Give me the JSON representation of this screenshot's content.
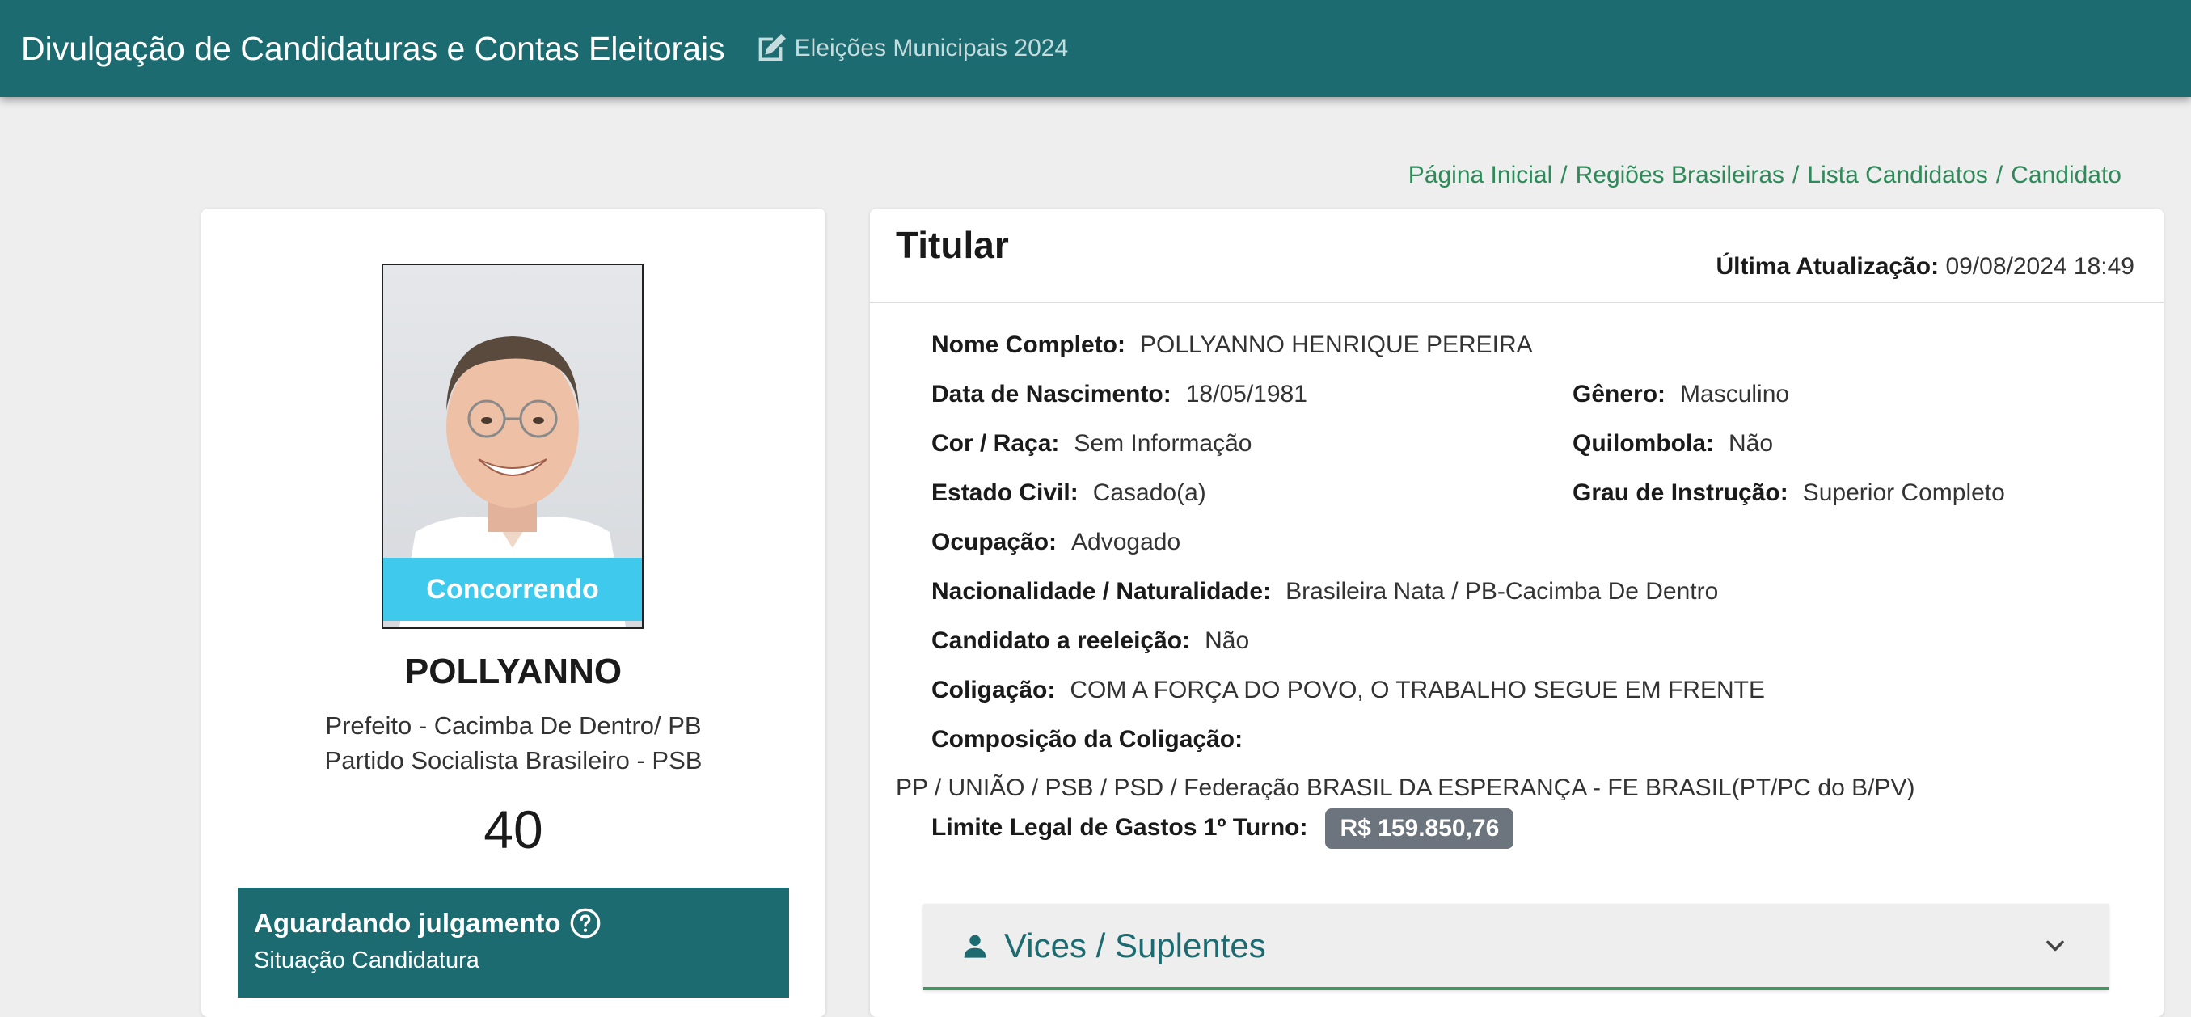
{
  "header": {
    "title": "Divulgação de Candidaturas e Contas Eleitorais",
    "election": "Eleições Municipais 2024",
    "icon": "edit-icon"
  },
  "breadcrumb": {
    "items": [
      "Página Inicial",
      "Regiões Brasileiras",
      "Lista Candidatos",
      "Candidato"
    ],
    "separator": "/"
  },
  "candidate": {
    "status_overlay": "Concorrendo",
    "name": "POLLYANNO",
    "office": "Prefeito - Cacimba De Dentro/ PB",
    "party": "Partido Socialista Brasileiro - PSB",
    "number": "40",
    "situation_title": "Aguardando julgamento",
    "situation_subtitle": "Situação Candidatura"
  },
  "details": {
    "section_title": "Titular",
    "last_update_label": "Última Atualização:",
    "last_update_value": "09/08/2024 18:49",
    "full_name_label": "Nome Completo:",
    "full_name": "POLLYANNO HENRIQUE PEREIRA",
    "birth_label": "Data de Nascimento:",
    "birth": "18/05/1981",
    "gender_label": "Gênero:",
    "gender": "Masculino",
    "race_label": "Cor / Raça:",
    "race": "Sem Informação",
    "quilombola_label": "Quilombola:",
    "quilombola": "Não",
    "civil_label": "Estado Civil:",
    "civil": "Casado(a)",
    "education_label": "Grau de Instrução:",
    "education": "Superior Completo",
    "occupation_label": "Ocupação:",
    "occupation": "Advogado",
    "nationality_label": "Nacionalidade / Naturalidade:",
    "nationality": "Brasileira Nata / PB-Cacimba De Dentro",
    "reelection_label": "Candidato a reeleição:",
    "reelection": "Não",
    "coalition_label": "Coligação:",
    "coalition": "COM A FORÇA DO POVO, O TRABALHO SEGUE EM FRENTE",
    "composition_label": "Composição da Coligação:",
    "composition": "PP / UNIÃO / PSB / PSD / Federação BRASIL DA ESPERANÇA - FE BRASIL(PT/PC do B/PV)",
    "spending_label": "Limite Legal de Gastos 1º Turno:",
    "spending": "R$ 159.850,76"
  },
  "accordion": {
    "label": "Vices / Suplentes",
    "icon": "person-icon"
  },
  "colors": {
    "header": "#1c6b71",
    "status_overlay": "#3fc9ec",
    "breadcrumb_link": "#2f8a5a",
    "badge": "#6c757d",
    "accordion_border": "#3c9a5f"
  }
}
